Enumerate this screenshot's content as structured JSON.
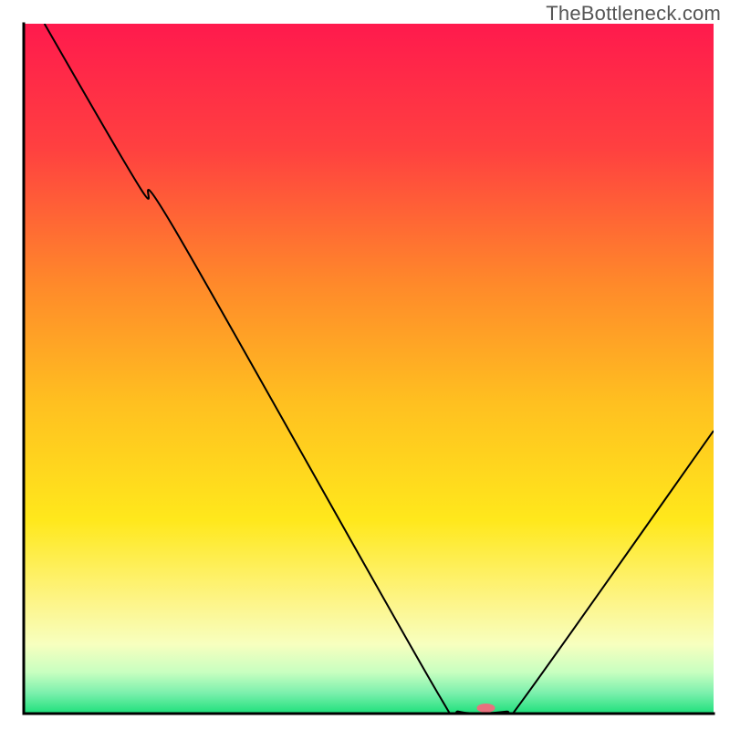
{
  "watermark": "TheBottleneck.com",
  "chart_data": {
    "type": "line",
    "title": "",
    "xlabel": "",
    "ylabel": "",
    "xlim": [
      0,
      100
    ],
    "ylim": [
      0,
      100
    ],
    "grid": false,
    "legend": false,
    "background": {
      "type": "vertical-gradient",
      "stops": [
        {
          "offset": 0.0,
          "color": "#ff1a4d"
        },
        {
          "offset": 0.18,
          "color": "#ff4040"
        },
        {
          "offset": 0.38,
          "color": "#ff8a2a"
        },
        {
          "offset": 0.55,
          "color": "#ffc020"
        },
        {
          "offset": 0.72,
          "color": "#ffe81c"
        },
        {
          "offset": 0.84,
          "color": "#fdf58a"
        },
        {
          "offset": 0.9,
          "color": "#f7ffbf"
        },
        {
          "offset": 0.94,
          "color": "#c8ffc0"
        },
        {
          "offset": 0.97,
          "color": "#7cf0ad"
        },
        {
          "offset": 1.0,
          "color": "#1ee07b"
        }
      ]
    },
    "series": [
      {
        "name": "bottleneck-curve",
        "stroke": "#000000",
        "stroke_width": 2,
        "points": [
          {
            "x": 3.0,
            "y": 100.0
          },
          {
            "x": 17.0,
            "y": 76.0
          },
          {
            "x": 22.0,
            "y": 70.0
          },
          {
            "x": 60.0,
            "y": 3.0
          },
          {
            "x": 63.0,
            "y": 0.3
          },
          {
            "x": 70.0,
            "y": 0.3
          },
          {
            "x": 72.0,
            "y": 1.5
          },
          {
            "x": 100.0,
            "y": 41.0
          }
        ]
      }
    ],
    "marker": {
      "name": "optimal-point",
      "x": 67.0,
      "y": 0.8,
      "rx": 10,
      "ry": 5,
      "fill": "#e9717e"
    },
    "axes": {
      "stroke": "#000000",
      "stroke_width": 3
    }
  }
}
